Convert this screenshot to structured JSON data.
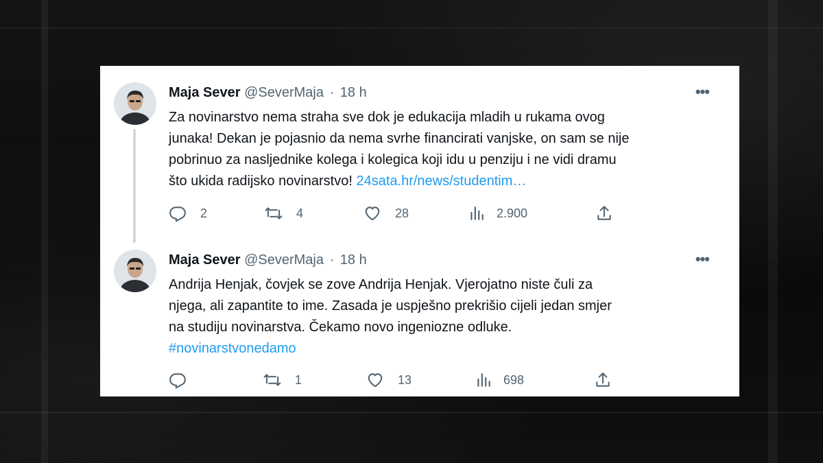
{
  "tweets": [
    {
      "author_name": "Maja Sever",
      "handle": "@SeverMaja",
      "separator": "·",
      "time": "18 h",
      "more_label": "•••",
      "text_lines": [
        "Za novinarstvo nema straha sve dok je edukacija mladih u rukama ovog",
        "junaka! Dekan je pojasnio da nema svrhe financirati vanjske, on sam se nije",
        "pobrinuo za nasljednike kolega i kolegica koji idu u penziju i ne vidi dramu",
        "što ukida radijsko novinarstvo! "
      ],
      "link_text": "24sata.hr/news/studentim…",
      "replies": "2",
      "retweets": "4",
      "likes": "28",
      "views": "2.900"
    },
    {
      "author_name": "Maja Sever",
      "handle": "@SeverMaja",
      "separator": "·",
      "time": "18 h",
      "more_label": "•••",
      "text_lines": [
        "Andrija Henjak, čovjek se zove Andrija Henjak. Vjerojatno niste čuli za",
        "njega, ali zapantite to ime. Zasada je uspješno prekrišio cijeli jedan smjer",
        "na studiju novinarstva. Čekamo novo ingeniozne odluke."
      ],
      "hashtag": "#novinarstvonedamo",
      "replies": "",
      "retweets": "1",
      "likes": "13",
      "views": "698"
    }
  ],
  "icons": {
    "reply": "reply-icon",
    "retweet": "retweet-icon",
    "like": "heart-icon",
    "views": "views-icon",
    "share": "share-icon",
    "more": "more-icon"
  },
  "colors": {
    "text": "#0f1419",
    "muted": "#536471",
    "link": "#1d9bf0",
    "thread_line": "#cfd9de"
  }
}
